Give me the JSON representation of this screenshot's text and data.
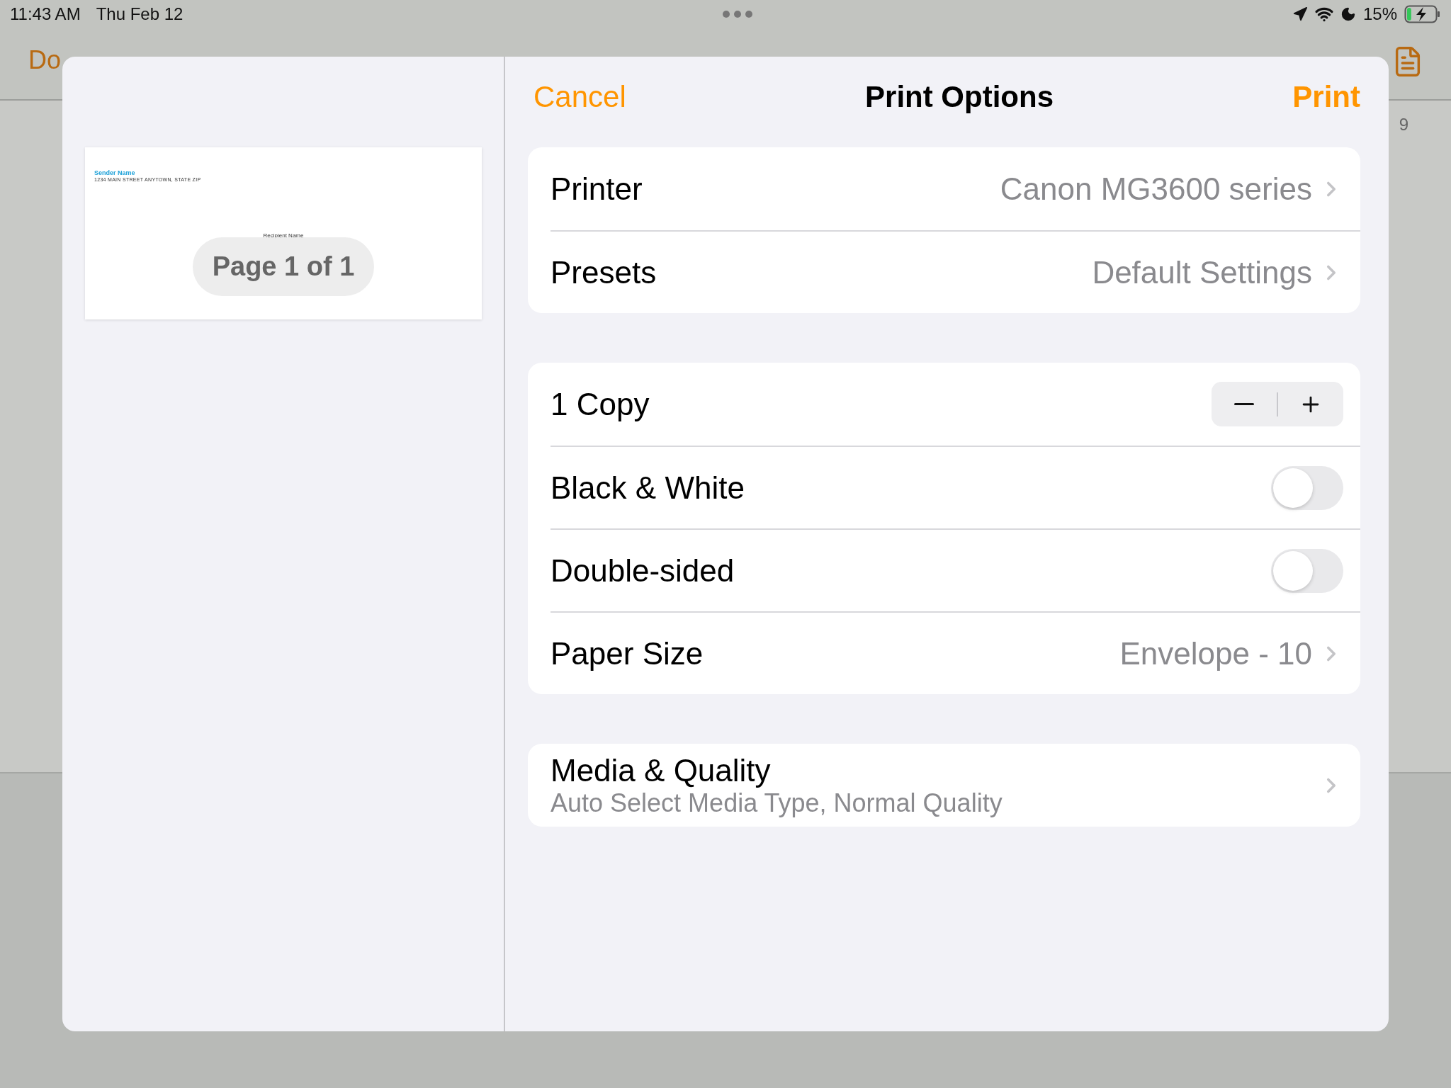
{
  "status_bar": {
    "time": "11:43 AM",
    "date": "Thu Feb 12",
    "battery": "15%"
  },
  "toolbar": {
    "back_label": "Do"
  },
  "ruler": {
    "mark": "9"
  },
  "preview": {
    "sender_name": "Sender Name",
    "sender_address": "1234 MAIN STREET ANYTOWN, STATE ZIP",
    "recipient_name": "Recipient Name",
    "page_label": "Page 1 of 1"
  },
  "header": {
    "cancel": "Cancel",
    "title": "Print Options",
    "print": "Print"
  },
  "groups": [
    [
      {
        "kind": "link",
        "label": "Printer",
        "value": "Canon MG3600 series"
      },
      {
        "kind": "link",
        "label": "Presets",
        "value": "Default Settings"
      }
    ],
    [
      {
        "kind": "stepper",
        "label": "1 Copy"
      },
      {
        "kind": "toggle",
        "label": "Black & White",
        "on": false
      },
      {
        "kind": "toggle",
        "label": "Double-sided",
        "on": false
      },
      {
        "kind": "link",
        "label": "Paper Size",
        "value": "Envelope - 10"
      }
    ],
    [
      {
        "kind": "detail",
        "label": "Media & Quality",
        "subtitle": "Auto Select Media Type, Normal Quality"
      }
    ]
  ]
}
